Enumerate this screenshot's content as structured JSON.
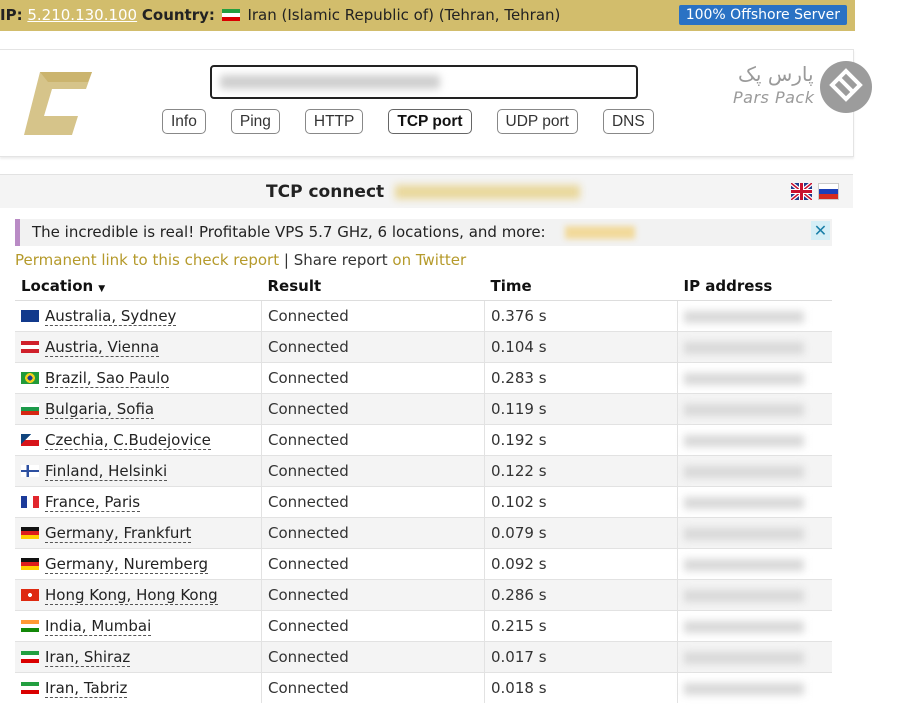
{
  "topbar": {
    "ip_label": "IP:",
    "ip_value": "5.210.130.100",
    "country_label": "Country:",
    "country_value": "Iran (Islamic Republic of) (Tehran, Tehran)",
    "offshore_label": "100% Offshore Server"
  },
  "search": {
    "value": ""
  },
  "tabs": [
    {
      "label": "Info"
    },
    {
      "label": "Ping"
    },
    {
      "label": "HTTP"
    },
    {
      "label": "TCP port"
    },
    {
      "label": "UDP port"
    },
    {
      "label": "DNS"
    }
  ],
  "brand": {
    "fa": "پارس پک",
    "en": "Pars Pack"
  },
  "section": {
    "title": "TCP connect"
  },
  "ad": {
    "text": "The incredible is real! Profitable VPS 5.7 GHz, 6 locations, and more:",
    "close": "✕"
  },
  "links": {
    "permanent": "Permanent link to this check report",
    "separator": "|",
    "share": "Share report",
    "twitter": "on Twitter"
  },
  "table": {
    "headers": {
      "location": "Location",
      "result": "Result",
      "time": "Time",
      "ip": "IP address"
    },
    "rows": [
      {
        "location": "Australia, Sydney",
        "result": "Connected",
        "time": "0.376 s",
        "flag": "au"
      },
      {
        "location": "Austria, Vienna",
        "result": "Connected",
        "time": "0.104 s",
        "flag": "at"
      },
      {
        "location": "Brazil, Sao Paulo",
        "result": "Connected",
        "time": "0.283 s",
        "flag": "br"
      },
      {
        "location": "Bulgaria, Sofia",
        "result": "Connected",
        "time": "0.119 s",
        "flag": "bg"
      },
      {
        "location": "Czechia, C.Budejovice",
        "result": "Connected",
        "time": "0.192 s",
        "flag": "cz"
      },
      {
        "location": "Finland, Helsinki",
        "result": "Connected",
        "time": "0.122 s",
        "flag": "fi"
      },
      {
        "location": "France, Paris",
        "result": "Connected",
        "time": "0.102 s",
        "flag": "fr"
      },
      {
        "location": "Germany, Frankfurt",
        "result": "Connected",
        "time": "0.079 s",
        "flag": "de"
      },
      {
        "location": "Germany, Nuremberg",
        "result": "Connected",
        "time": "0.092 s",
        "flag": "de"
      },
      {
        "location": "Hong Kong, Hong Kong",
        "result": "Connected",
        "time": "0.286 s",
        "flag": "hk"
      },
      {
        "location": "India, Mumbai",
        "result": "Connected",
        "time": "0.215 s",
        "flag": "in"
      },
      {
        "location": "Iran, Shiraz",
        "result": "Connected",
        "time": "0.017 s",
        "flag": "ir"
      },
      {
        "location": "Iran, Tabriz",
        "result": "Connected",
        "time": "0.018 s",
        "flag": "ir"
      }
    ]
  },
  "colors": {
    "topbar_bg": "#d2bd6c",
    "offshore_bg": "#2a72c4",
    "link": "#b59a2b",
    "ad_accent": "#b98bc5"
  }
}
